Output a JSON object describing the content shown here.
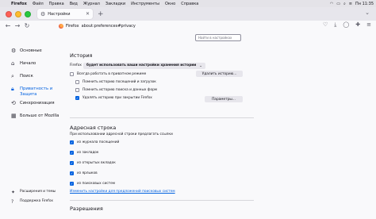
{
  "menubar": {
    "apple": "",
    "items": [
      "Firefox",
      "Файл",
      "Правка",
      "Вид",
      "Журнал",
      "Закладки",
      "Инструменты",
      "Окно",
      "Справка"
    ],
    "right_time": "Пн 11:35"
  },
  "tab": {
    "label": "Настройки"
  },
  "urlbar": {
    "brand": "Firefox",
    "url": "about:preferences#privacy"
  },
  "search": {
    "placeholder": "Найти в настройках"
  },
  "sidebar": {
    "items": [
      {
        "label": "Основные",
        "icon": "gear-icon"
      },
      {
        "label": "Начало",
        "icon": "home-icon"
      },
      {
        "label": "Поиск",
        "icon": "search-icon"
      },
      {
        "label": "Приватность и Защита",
        "icon": "lock-icon"
      },
      {
        "label": "Синхронизация",
        "icon": "sync-icon"
      },
      {
        "label": "Больше от Mozilla",
        "icon": "mozilla-icon"
      }
    ],
    "bottom": [
      {
        "label": "Расширения и темы",
        "icon": "puzzle-icon"
      },
      {
        "label": "Поддержка Firefox",
        "icon": "help-icon"
      }
    ]
  },
  "history": {
    "title": "История",
    "prefix": "Firefox",
    "select_value": "будет использовать ваши настройки хранения истории",
    "clear_button": "Удалить историю...",
    "options": [
      {
        "label": "Всегда работать в приватном режиме",
        "checked": false
      },
      {
        "label": "Помнить историю посещений и загрузок",
        "checked": false
      },
      {
        "label": "Помнить историю поиска и данных форм",
        "checked": false
      },
      {
        "label": "Удалять историю при закрытии Firefox",
        "checked": true
      }
    ],
    "params_button": "Параметры..."
  },
  "addressbar": {
    "title": "Адресная строка",
    "subtitle": "При использовании адресной строки предлагать ссылки",
    "options": [
      {
        "label": "из журнала посещений",
        "checked": true
      },
      {
        "label": "из закладок",
        "checked": true
      },
      {
        "label": "из открытых вкладок",
        "checked": true
      },
      {
        "label": "из ярлыков",
        "checked": true
      },
      {
        "label": "из поисковых систем",
        "checked": true
      }
    ],
    "link": "Изменить настройки для предложений поисковых систем"
  },
  "permissions": {
    "title": "Разрешения"
  }
}
